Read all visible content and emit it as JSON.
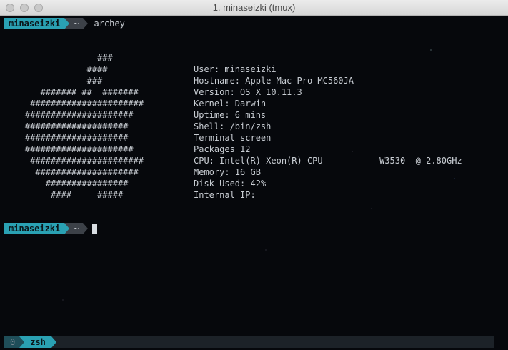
{
  "window": {
    "title": "1. minaseizki (tmux)"
  },
  "prompt1": {
    "user": "minaseizki",
    "dir": "~",
    "command": "archey"
  },
  "prompt2": {
    "user": "minaseizki",
    "dir": "~"
  },
  "logo_lines": [
    "                  ###",
    "                ####",
    "                ###",
    "       ####### ##  #######",
    "     ######################",
    "    #####################",
    "    ####################",
    "    ####################",
    "    #####################",
    "     ######################",
    "      ####################",
    "        ################",
    "         ####     #####"
  ],
  "info_lines": [
    "User: minaseizki",
    "Hostname: Apple-Mac-Pro-MC560JA",
    "Version: OS X 10.11.3",
    "Kernel: Darwin",
    "Uptime: 6 mins",
    "Shell: /bin/zsh",
    "Terminal screen",
    "Packages 12",
    "CPU: Intel(R) Xeon(R) CPU           W3530  @ 2.80GHz",
    "Memory: 16 GB",
    "Disk Used: 42%",
    "Internal IP:"
  ],
  "statusbar": {
    "index": "0",
    "name": "zsh"
  },
  "colors": {
    "accent": "#2aa1b3",
    "segment_dark": "#3c4148",
    "background": "#06080c"
  }
}
